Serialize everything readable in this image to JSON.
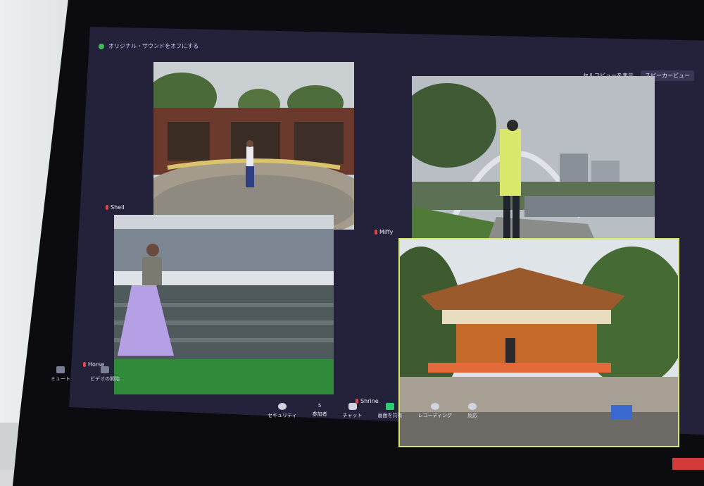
{
  "top_bar": {
    "sound_notice": "オリジナル・サウンドをオフにする"
  },
  "view_controls": {
    "self_view": "セルフビューを表示",
    "speaker_view": "スピーカービュー"
  },
  "participants": [
    {
      "name": "Sheil"
    },
    {
      "name": "Horse"
    },
    {
      "name": "Miffy"
    },
    {
      "name": "Shrine"
    }
  ],
  "left_controls": {
    "mute": "ミュート",
    "video": "ビデオの開始"
  },
  "toolbar": {
    "security": "セキュリティ",
    "participants": "参加者",
    "participants_count": "5",
    "chat": "チャット",
    "share": "画面を共有",
    "record": "レコーディング",
    "reactions": "反応"
  },
  "colors": {
    "active_speaker_border": "#d6e66a",
    "share_green": "#2ecc71"
  }
}
